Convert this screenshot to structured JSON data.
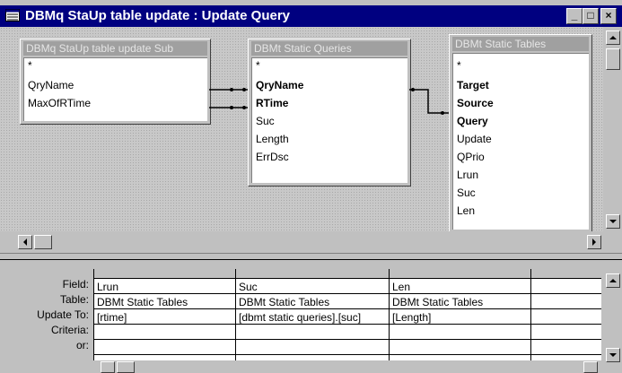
{
  "window": {
    "title": "DBMq StaUp table update : Update Query",
    "buttons": [
      "_",
      "□",
      "×"
    ]
  },
  "tables": [
    {
      "title": "DBMq StaUp table update Sub",
      "fields": [
        {
          "name": "*",
          "bold": false
        },
        {
          "name": "QryName",
          "bold": false
        },
        {
          "name": "MaxOfRTime",
          "bold": false
        }
      ]
    },
    {
      "title": "DBMt Static Queries",
      "fields": [
        {
          "name": "*",
          "bold": false
        },
        {
          "name": "QryName",
          "bold": true
        },
        {
          "name": "RTime",
          "bold": true
        },
        {
          "name": "Suc",
          "bold": false
        },
        {
          "name": "Length",
          "bold": false
        },
        {
          "name": "ErrDsc",
          "bold": false
        }
      ]
    },
    {
      "title": "DBMt Static Tables",
      "fields": [
        {
          "name": "*",
          "bold": false
        },
        {
          "name": "Target",
          "bold": true
        },
        {
          "name": "Source",
          "bold": true
        },
        {
          "name": "Query",
          "bold": true
        },
        {
          "name": "Update",
          "bold": false
        },
        {
          "name": "QPrio",
          "bold": false
        },
        {
          "name": "Lrun",
          "bold": false
        },
        {
          "name": "Suc",
          "bold": false
        },
        {
          "name": "Len",
          "bold": false
        }
      ]
    }
  ],
  "grid": {
    "row_labels": [
      "Field:",
      "Table:",
      "Update To:",
      "Criteria:",
      "or:"
    ],
    "columns": [
      {
        "field": "Lrun",
        "table": "DBMt Static Tables",
        "update_to": "[rtime]",
        "criteria": "",
        "or": ""
      },
      {
        "field": "Suc",
        "table": "DBMt Static Tables",
        "update_to": "[dbmt static queries].[suc]",
        "criteria": "",
        "or": ""
      },
      {
        "field": "Len",
        "table": "DBMt Static Tables",
        "update_to": "[Length]",
        "criteria": "",
        "or": ""
      },
      {
        "field": "",
        "table": "",
        "update_to": "",
        "criteria": "",
        "or": ""
      }
    ]
  }
}
